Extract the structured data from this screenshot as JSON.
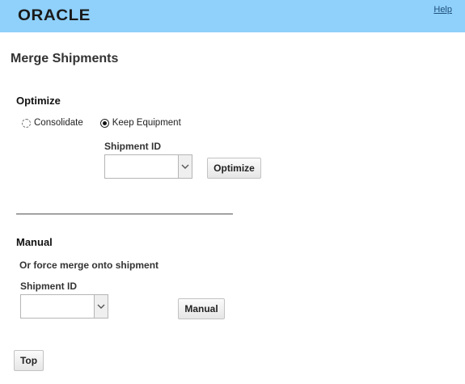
{
  "header": {
    "logo": "ORACLE",
    "help": "Help"
  },
  "page_title": "Merge Shipments",
  "optimize": {
    "title": "Optimize",
    "radio_consolidate": {
      "label": "Consolidate",
      "selected": false
    },
    "radio_keep_equipment": {
      "label": "Keep Equipment",
      "selected": true
    },
    "shipment_label": "Shipment ID",
    "shipment_value": "",
    "button": "Optimize"
  },
  "manual": {
    "title": "Manual",
    "description": "Or force merge onto shipment",
    "shipment_label": "Shipment ID",
    "shipment_value": "",
    "button": "Manual"
  },
  "top_button": "Top",
  "colors": {
    "header_bg": "#8fd1fb",
    "link": "#1f4f7a"
  }
}
